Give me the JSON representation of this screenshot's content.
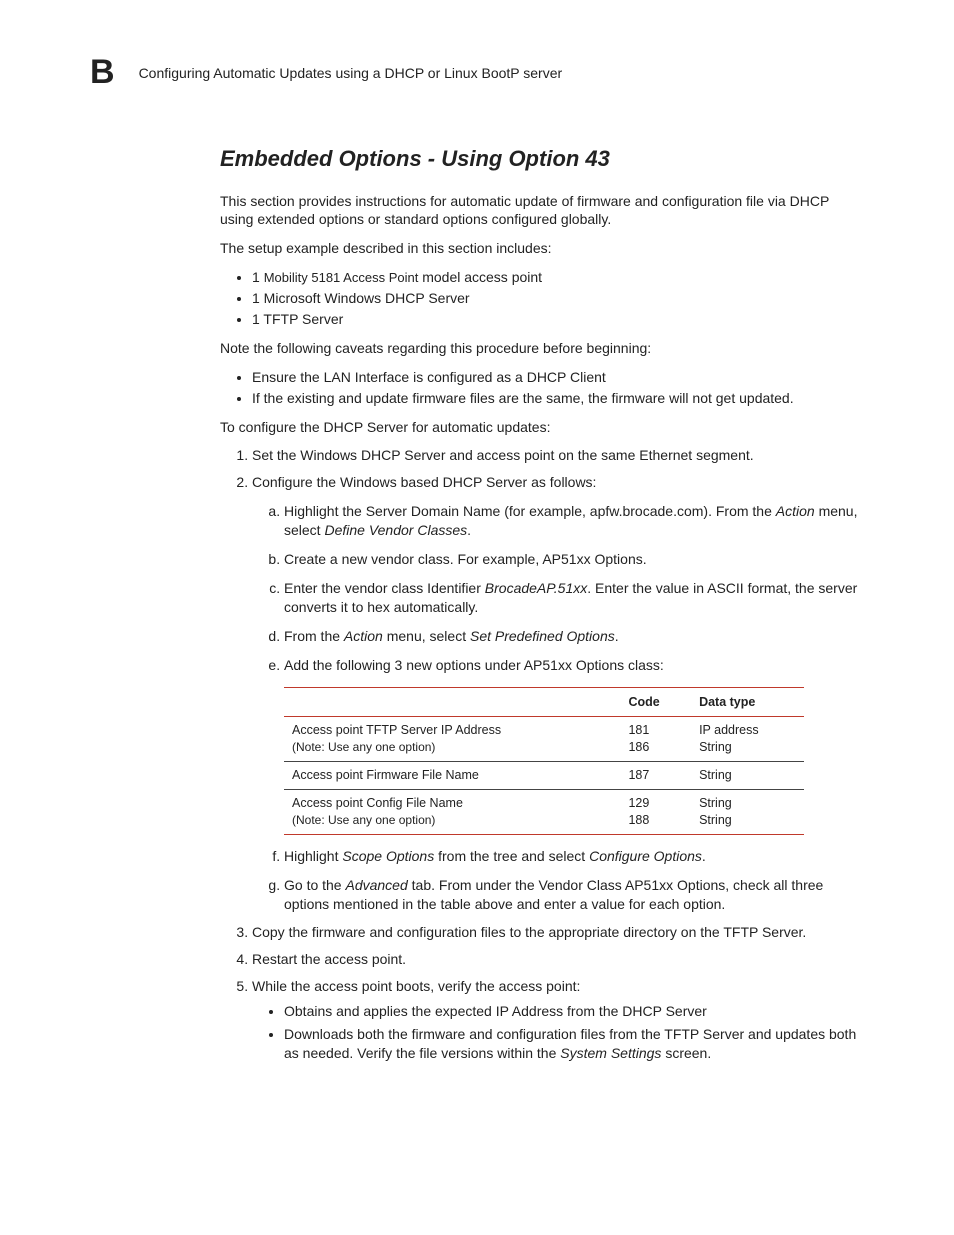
{
  "header": {
    "letter": "B",
    "title": "Configuring Automatic Updates using a DHCP or Linux BootP server"
  },
  "heading": "Embedded Options - Using Option 43",
  "intro": "This section provides instructions for automatic update of firmware and configuration file via DHCP using extended options or standard options configured globally.",
  "setupLine": "The setup example described in this section includes:",
  "setup": {
    "b1a": "1 ",
    "b1b": "Mobility 5181 Access Point",
    "b1c": " model access point",
    "b2": "1 Microsoft Windows DHCP Server",
    "b3": "1 TFTP Server"
  },
  "caveatLine": "Note the following caveats regarding this procedure before beginning:",
  "caveats": {
    "c1": "Ensure the LAN Interface is configured as a DHCP Client",
    "c2": "If the existing and update firmware files are the same, the firmware will not get updated."
  },
  "configLine": "To configure the DHCP Server for automatic updates:",
  "steps": {
    "s1": "Set the Windows DHCP Server and access point on the same Ethernet segment.",
    "s2": "Configure the Windows based DHCP Server as follows:",
    "a": {
      "a1a": "Highlight the Server Domain Name (for example, apfw.brocade.com). From the ",
      "a1b": "Action",
      "a1c": " menu, select ",
      "a1d": "Define Vendor Classes",
      "a1e": ".",
      "a2": "Create a new vendor class. For example, AP51xx Options.",
      "a3a": "Enter the vendor class Identifier ",
      "a3b": "BrocadeAP.51xx",
      "a3c": ". Enter the value in ASCII format, the server converts it to hex automatically.",
      "a4a": "From the ",
      "a4b": "Action",
      "a4c": " menu, select ",
      "a4d": "Set Predefined Options",
      "a4e": ".",
      "a5": "Add the following 3 new options under AP51xx Options class:",
      "a6a": "Highlight ",
      "a6b": "Scope Options",
      "a6c": " from the tree and select ",
      "a6d": "Configure Options",
      "a6e": ".",
      "a7a": "Go to the ",
      "a7b": "Advanced",
      "a7c": " tab. From under the Vendor Class AP51xx Options, check all three options mentioned in the table above and enter a value for each option."
    },
    "s3": "Copy the firmware and configuration files to the appropriate directory on the TFTP Server.",
    "s4": "Restart the access point.",
    "s5": "While the access point boots, verify the access point:",
    "s5b1": "Obtains and applies the expected IP Address from the DHCP Server",
    "s5b2a": "Downloads both the firmware and configuration files from the TFTP Server and updates both as needed. Verify the file versions within the ",
    "s5b2b": "System Settings",
    "s5b2c": " screen."
  },
  "table": {
    "h2": "Code",
    "h3": "Data type",
    "r1": {
      "name": "Access point TFTP Server IP Address",
      "note": "(Note: Use any one option)",
      "c1": "181",
      "c2": "186",
      "d1": "IP address",
      "d2": "String"
    },
    "r2": {
      "name": "Access point Firmware File Name",
      "c1": "187",
      "d1": "String"
    },
    "r3": {
      "name": "Access point Config File Name",
      "note": "(Note: Use any one option)",
      "c1": "129",
      "c2": "188",
      "d1": "String",
      "d2": "String"
    }
  }
}
